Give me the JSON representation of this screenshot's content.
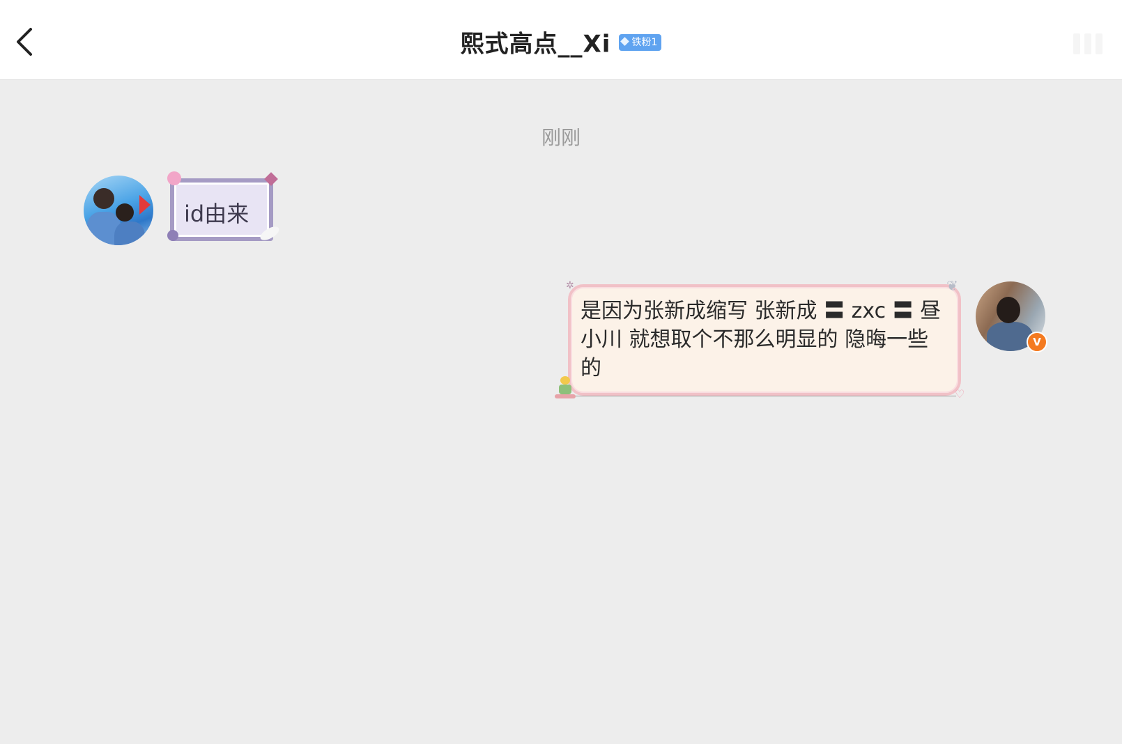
{
  "header": {
    "title": "熙式高点__Xi",
    "fan_badge": "铁粉1",
    "back_icon": "chevron-left-icon",
    "more_icon": "more-icon"
  },
  "chat": {
    "timestamp": "刚刚",
    "messages": [
      {
        "sender": "other",
        "text": "id由来"
      },
      {
        "sender": "self",
        "text": "是因为张新成缩写 张新成 〓 zxc 〓 昼小川 就想取个不那么明显的 隐晦一些的",
        "verified_badge": "V"
      }
    ]
  },
  "colors": {
    "background": "#ededed",
    "header_bg": "#ffffff",
    "badge_blue": "#5fa3f0",
    "verified_orange": "#f47a20",
    "left_bubble_border": "#a59bc4",
    "right_bubble_border": "#f1c1c7"
  }
}
